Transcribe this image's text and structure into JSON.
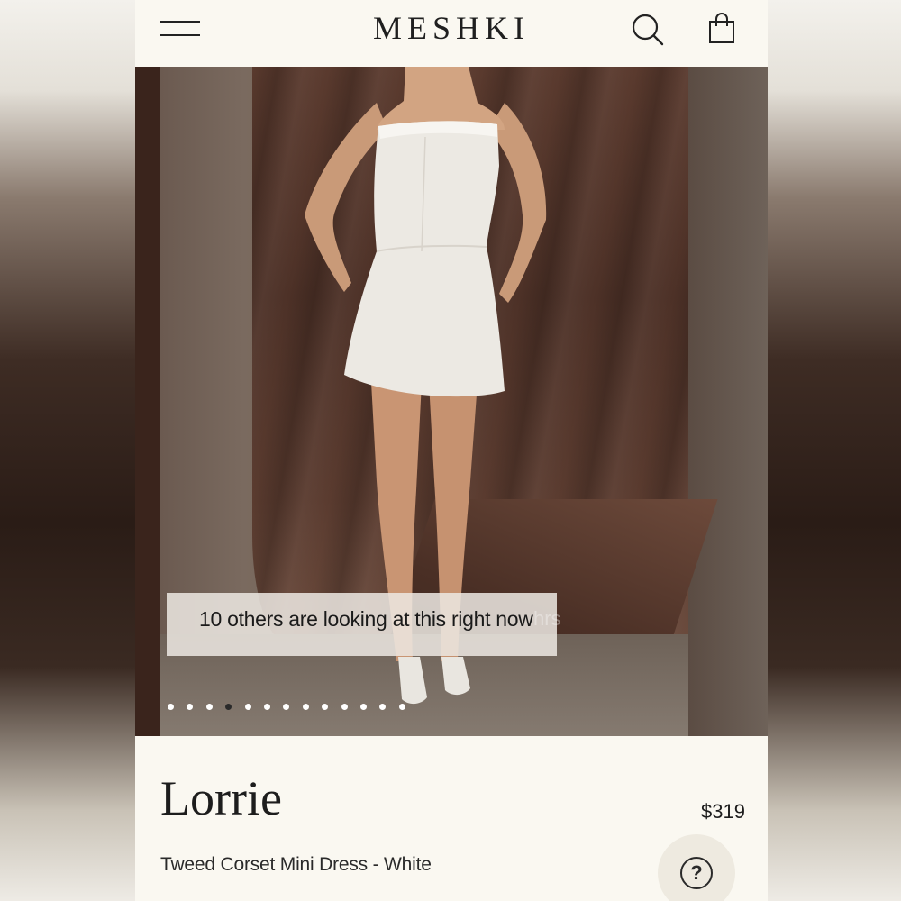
{
  "header": {
    "brand": "MESHKI",
    "menu_icon": "hamburger-menu-icon",
    "search_icon": "search-icon",
    "bag_icon": "shopping-bag-icon"
  },
  "gallery": {
    "overlay_text": "10 others are looking at this right now",
    "ghost_text": "hrs",
    "dot_count": 13,
    "active_dot_index": 3
  },
  "product": {
    "name": "Lorrie",
    "price": "$319",
    "subtitle": "Tweed Corset Mini Dress - White"
  },
  "help": {
    "icon": "question-mark-icon",
    "glyph": "?"
  },
  "colors": {
    "page_bg": "#faf8f1",
    "text": "#1d1d1d",
    "help_bg": "#eeeae0"
  }
}
